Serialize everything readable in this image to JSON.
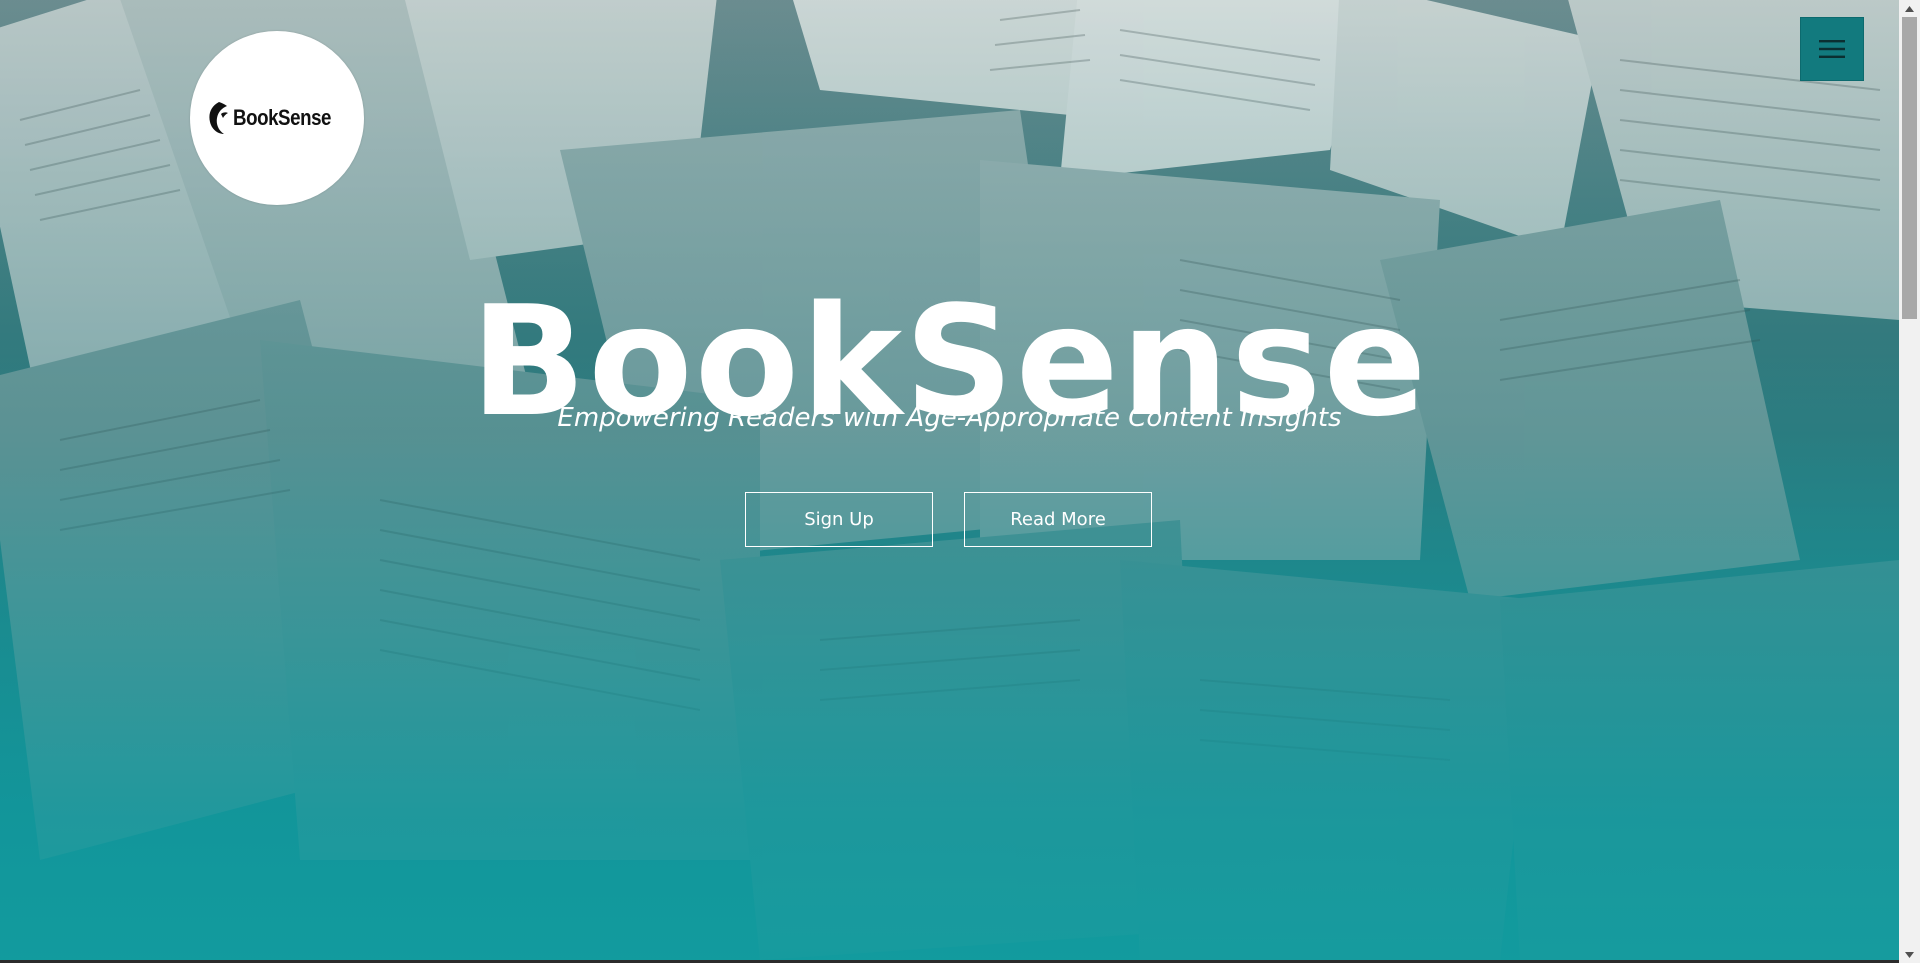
{
  "header": {
    "logo_text": "BookSense",
    "menu_icon": "hamburger-menu-icon"
  },
  "hero": {
    "title": "BookSense",
    "subtitle": "Empowering Readers with Age-Appropriate Content Insights",
    "buttons": {
      "signup_label": "Sign Up",
      "readmore_label": "Read More"
    },
    "background": "open-books-photo"
  },
  "colors": {
    "accent": "#127a7e",
    "teal_bottom": "#17979b",
    "text": "#ffffff"
  },
  "scrollbar": {
    "up_icon": "scroll-up-arrow-icon",
    "down_icon": "scroll-down-arrow-icon"
  }
}
